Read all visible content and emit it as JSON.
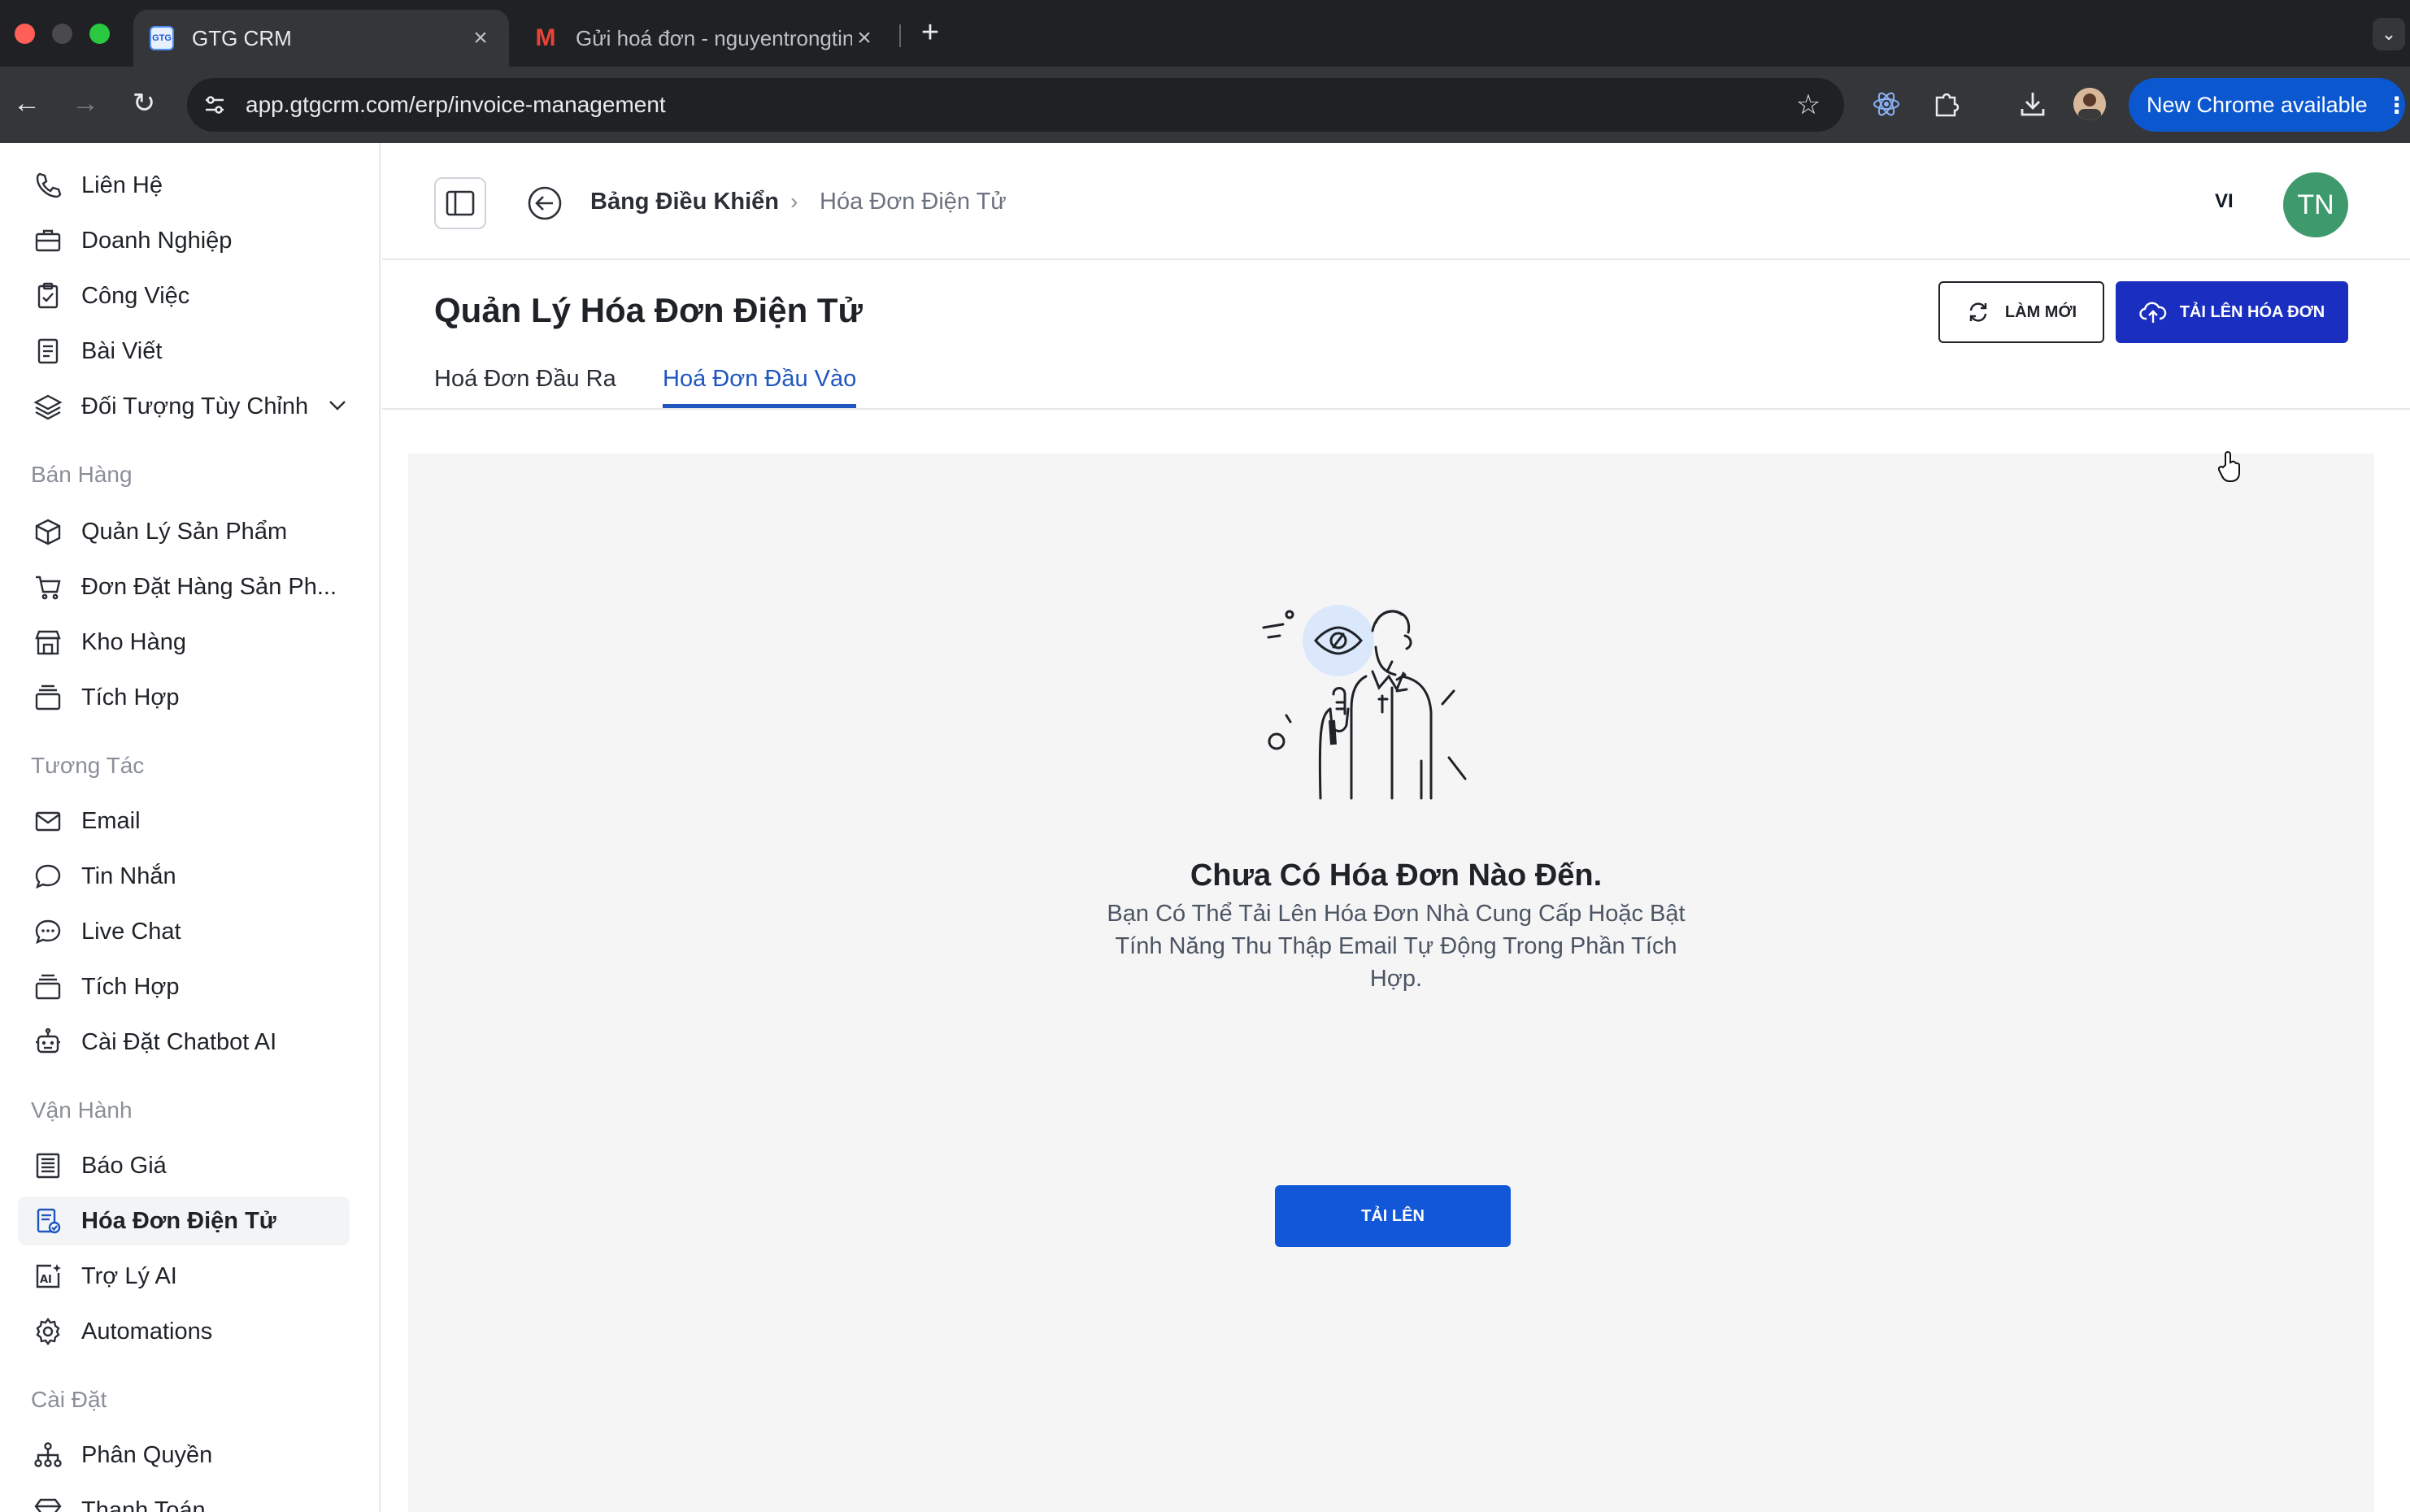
{
  "browser": {
    "tabs": [
      {
        "title": "GTG CRM",
        "favicon": "gtg-favicon",
        "active": true
      },
      {
        "title": "Gửi hoá đơn - nguyentrongtin",
        "favicon": "gmail-icon",
        "active": false
      }
    ],
    "url": "app.gtgcrm.com/erp/invoice-management",
    "update_label": "New Chrome available"
  },
  "sidebar": {
    "items_top": [
      {
        "label": "Liên Hệ",
        "icon": "phone-icon"
      },
      {
        "label": "Doanh Nghiệp",
        "icon": "briefcase-icon"
      },
      {
        "label": "Công Việc",
        "icon": "clipboard-icon"
      },
      {
        "label": "Bài Viết",
        "icon": "document-icon"
      },
      {
        "label": "Đối Tượng Tùy Chỉnh",
        "icon": "layers-icon"
      }
    ],
    "section_sales": "Bán Hàng",
    "items_sales": [
      {
        "label": "Quản Lý Sản Phẩm",
        "icon": "box-icon"
      },
      {
        "label": "Đơn Đặt Hàng Sản Ph...",
        "icon": "cart-icon"
      },
      {
        "label": "Kho Hàng",
        "icon": "store-icon"
      },
      {
        "label": "Tích Hợp",
        "icon": "stack-icon"
      }
    ],
    "section_interaction": "Tương Tác",
    "items_interaction": [
      {
        "label": "Email",
        "icon": "mail-icon"
      },
      {
        "label": "Tin Nhắn",
        "icon": "chat-bubble-icon"
      },
      {
        "label": "Live Chat",
        "icon": "live-chat-icon"
      },
      {
        "label": "Tích Hợp",
        "icon": "stack-icon"
      },
      {
        "label": "Cài Đặt Chatbot AI",
        "icon": "robot-icon"
      }
    ],
    "section_operations": "Vận Hành",
    "items_operations": [
      {
        "label": "Báo Giá",
        "icon": "quote-icon"
      },
      {
        "label": "Hóa Đơn Điện Tử",
        "icon": "invoice-icon",
        "active": true
      },
      {
        "label": "Trợ Lý AI",
        "icon": "ai-icon"
      },
      {
        "label": "Automations",
        "icon": "gear-icon"
      }
    ],
    "section_settings": "Cài Đặt",
    "items_settings": [
      {
        "label": "Phân Quyền",
        "icon": "hierarchy-icon"
      },
      {
        "label": "Thanh Toán",
        "icon": "diamond-icon"
      }
    ]
  },
  "header": {
    "breadcrumb_home": "Bảng Điều Khiển",
    "breadcrumb_sep": "›",
    "breadcrumb_current": "Hóa Đơn Điện Tử",
    "language": "VI",
    "avatar_initials": "TN"
  },
  "page": {
    "title": "Quản Lý Hóa Đơn Điện Tử",
    "refresh_label": "LÀM MỚI",
    "upload_label": "TẢI LÊN HÓA ĐƠN",
    "tabs": [
      {
        "label": "Hoá Đơn Đầu Ra",
        "selected": false
      },
      {
        "label": "Hoá Đơn Đầu Vào",
        "selected": true
      }
    ]
  },
  "empty_state": {
    "title": "Chưa Có Hóa Đơn Nào Đến.",
    "description": "Bạn Có Thể Tải Lên Hóa Đơn Nhà Cung Cấp Hoặc Bật Tính Năng Thu Thập Email Tự Động Trong Phần Tích Hợp.",
    "button_label": "TẢI LÊN"
  },
  "colors": {
    "primary": "#1a2fbf",
    "tab_active": "#1f56c0",
    "avatar": "#3e9a6c",
    "chrome_update": "#0b57d0"
  }
}
